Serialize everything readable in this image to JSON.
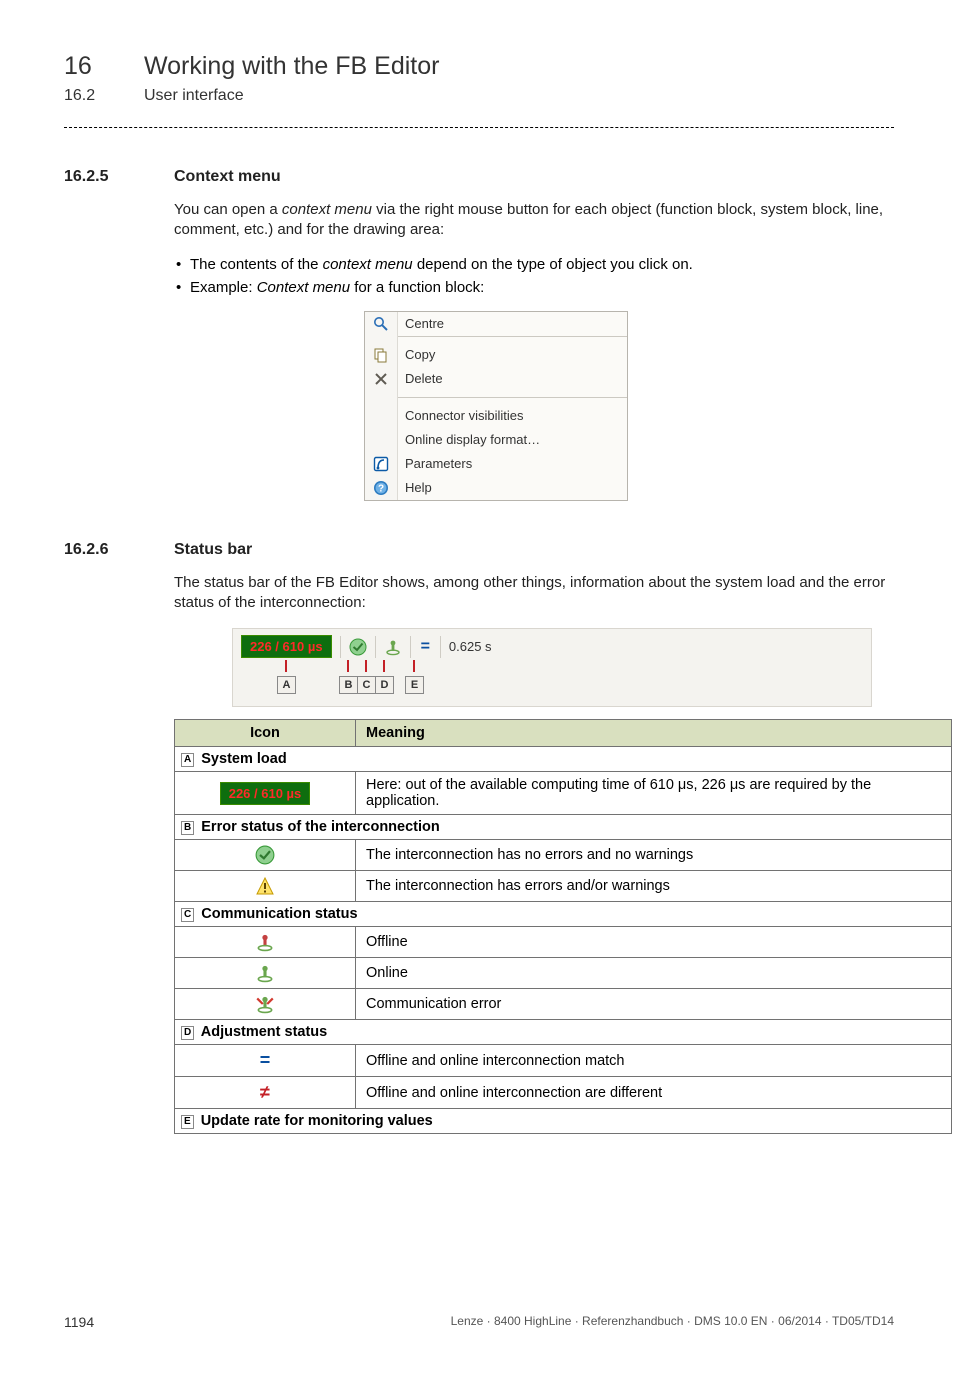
{
  "header": {
    "chapter_num": "16",
    "chapter_title": "Working with the FB Editor",
    "section_num": "16.2",
    "section_title": "User interface"
  },
  "ctx": {
    "heading_num": "16.2.5",
    "heading": "Context menu",
    "intro_a": "You can open a ",
    "intro_em1": "context menu",
    "intro_b": " via the right mouse button for each object (function block, system block, line, comment, etc.) and for the drawing area:",
    "bullet1_a": "The contents of the ",
    "bullet1_em": "context menu",
    "bullet1_b": " depend on the type of object you click on.",
    "bullet2_a": "Example: ",
    "bullet2_em": "Context menu",
    "bullet2_b": " for a function block:",
    "items": {
      "centre": "Centre",
      "copy": "Copy",
      "delete": "Delete",
      "connvis": "Connector visibilities",
      "odfmt": "Online display format…",
      "params": "Parameters",
      "help": "Help"
    }
  },
  "status": {
    "heading_num": "16.2.6",
    "heading": "Status bar",
    "intro": "The status bar of the FB Editor shows, among other things, information about the system load and the error status of the interconnection:",
    "badge": "226 / 610 µs",
    "time": "0.625 s",
    "labels": {
      "A": "A",
      "B": "B",
      "C": "C",
      "D": "D",
      "E": "E"
    }
  },
  "table": {
    "head_icon": "Icon",
    "head_meaning": "Meaning",
    "grpA_key": "A",
    "grpA": "System load",
    "rowA_badge": "226 / 610 µs",
    "rowA_mean": "Here: out of the available computing time of 610 μs, 226 μs are required by the application.",
    "grpB_key": "B",
    "grpB": "Error status of the interconnection",
    "rowB1": "The interconnection has no errors and no warnings",
    "rowB2": "The interconnection has errors and/or warnings",
    "grpC_key": "C",
    "grpC": "Communication status",
    "rowC1": "Offline",
    "rowC2": "Online",
    "rowC3": "Communication error",
    "grpD_key": "D",
    "grpD": "Adjustment status",
    "rowD1": "Offline and online interconnection match",
    "rowD2": "Offline and online interconnection are different",
    "grpE_key": "E",
    "grpE": "Update rate for monitoring values"
  },
  "footer": {
    "pagenum": "1194",
    "right": "Lenze · 8400 HighLine · Referenzhandbuch · DMS 10.0 EN · 06/2014 · TD05/TD14"
  }
}
